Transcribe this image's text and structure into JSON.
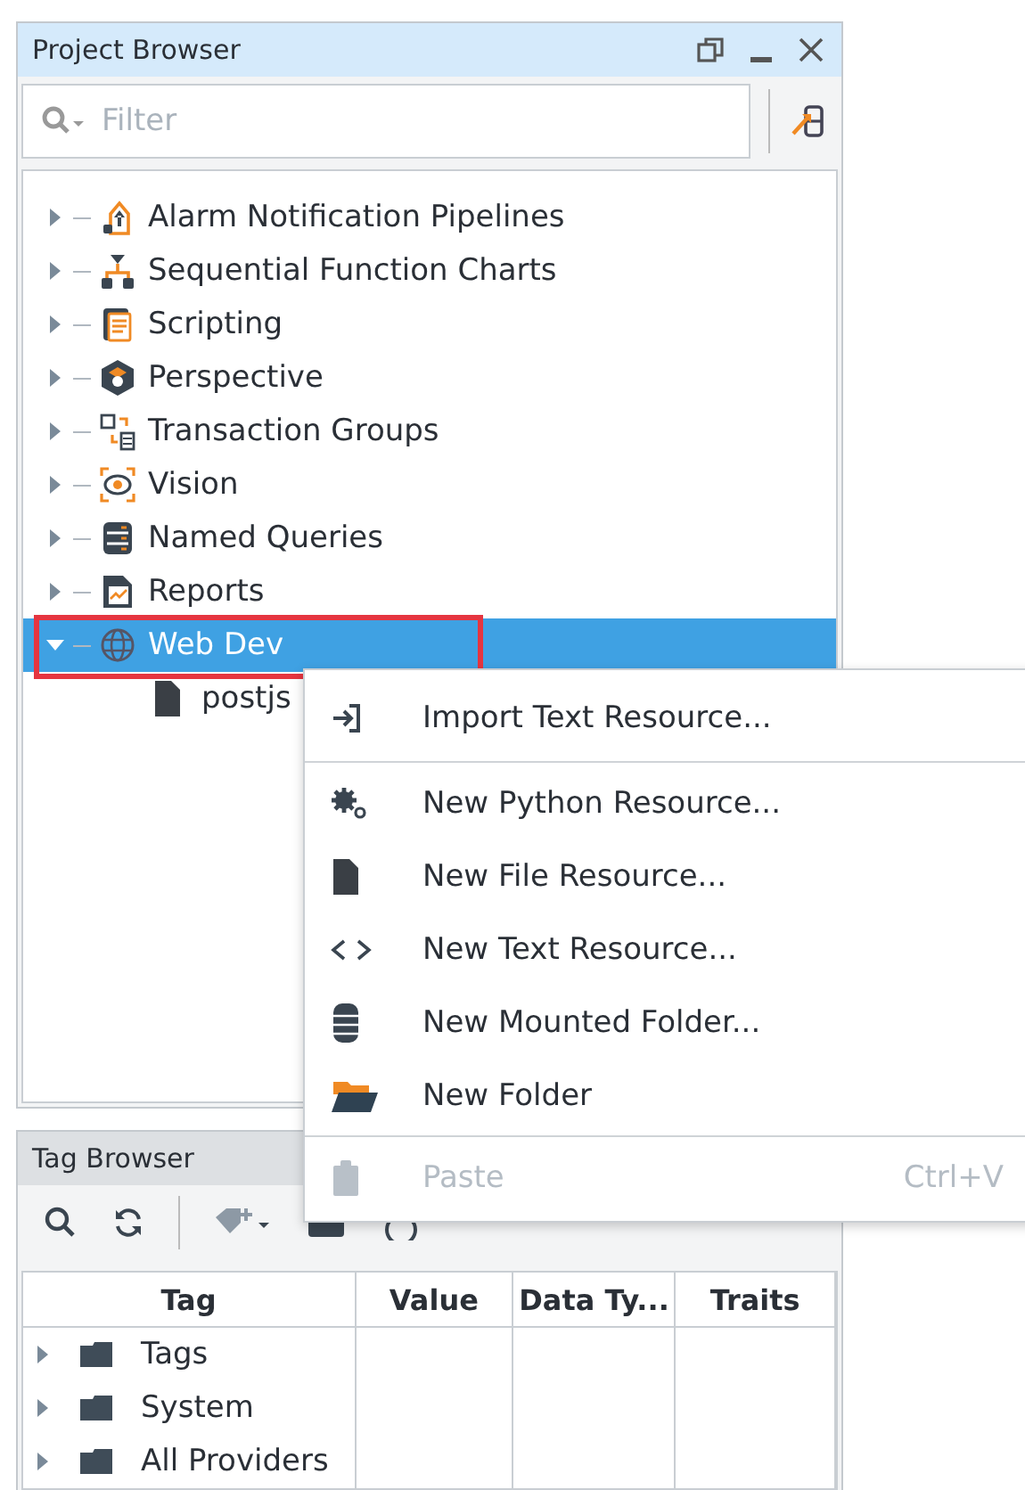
{
  "project_browser": {
    "title": "Project Browser",
    "filter": {
      "placeholder": "Filter"
    },
    "tree": [
      {
        "label": "Alarm Notification Pipelines",
        "expanded": false,
        "selected": false,
        "highlighted": false
      },
      {
        "label": "Sequential Function Charts",
        "expanded": false,
        "selected": false,
        "highlighted": false
      },
      {
        "label": "Scripting",
        "expanded": false,
        "selected": false,
        "highlighted": false
      },
      {
        "label": "Perspective",
        "expanded": false,
        "selected": false,
        "highlighted": false
      },
      {
        "label": "Transaction Groups",
        "expanded": false,
        "selected": false,
        "highlighted": false
      },
      {
        "label": "Vision",
        "expanded": false,
        "selected": false,
        "highlighted": false
      },
      {
        "label": "Named Queries",
        "expanded": false,
        "selected": false,
        "highlighted": false
      },
      {
        "label": "Reports",
        "expanded": false,
        "selected": false,
        "highlighted": false
      },
      {
        "label": "Web Dev",
        "expanded": true,
        "selected": true,
        "highlighted": true,
        "children": [
          {
            "label": "postjs"
          }
        ]
      }
    ]
  },
  "context_menu": [
    {
      "kind": "item",
      "label": "Import Text Resource...",
      "disabled": false
    },
    {
      "kind": "separator"
    },
    {
      "kind": "item",
      "label": "New Python Resource...",
      "disabled": false
    },
    {
      "kind": "item",
      "label": "New File Resource...",
      "disabled": false
    },
    {
      "kind": "item",
      "label": "New Text Resource...",
      "disabled": false
    },
    {
      "kind": "item",
      "label": "New Mounted Folder...",
      "disabled": false
    },
    {
      "kind": "item",
      "label": "New Folder",
      "disabled": false
    },
    {
      "kind": "separator"
    },
    {
      "kind": "item",
      "label": "Paste",
      "disabled": true,
      "shortcut": "Ctrl+V"
    }
  ],
  "tag_browser": {
    "title": "Tag Browser",
    "columns": [
      "Tag",
      "Value",
      "Data Ty...",
      "Traits"
    ],
    "rows": [
      {
        "tag": "Tags"
      },
      {
        "tag": "System"
      },
      {
        "tag": "All Providers"
      }
    ]
  }
}
